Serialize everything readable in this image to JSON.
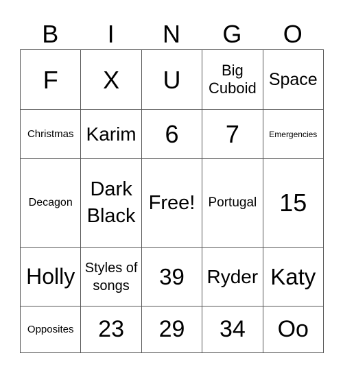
{
  "header": [
    "B",
    "I",
    "N",
    "G",
    "O"
  ],
  "rows": [
    [
      "F",
      "X",
      "U",
      "Big Cuboid",
      "Space"
    ],
    [
      "Christmas",
      "Karim",
      "6",
      "7",
      "Emergencies"
    ],
    [
      "Decagon",
      "Dark Black",
      "Free!",
      "Portugal",
      "15"
    ],
    [
      "Holly",
      "Styles of songs",
      "39",
      "Ryder",
      "Katy"
    ],
    [
      "Opposites",
      "23",
      "29",
      "34",
      "Oo"
    ]
  ]
}
